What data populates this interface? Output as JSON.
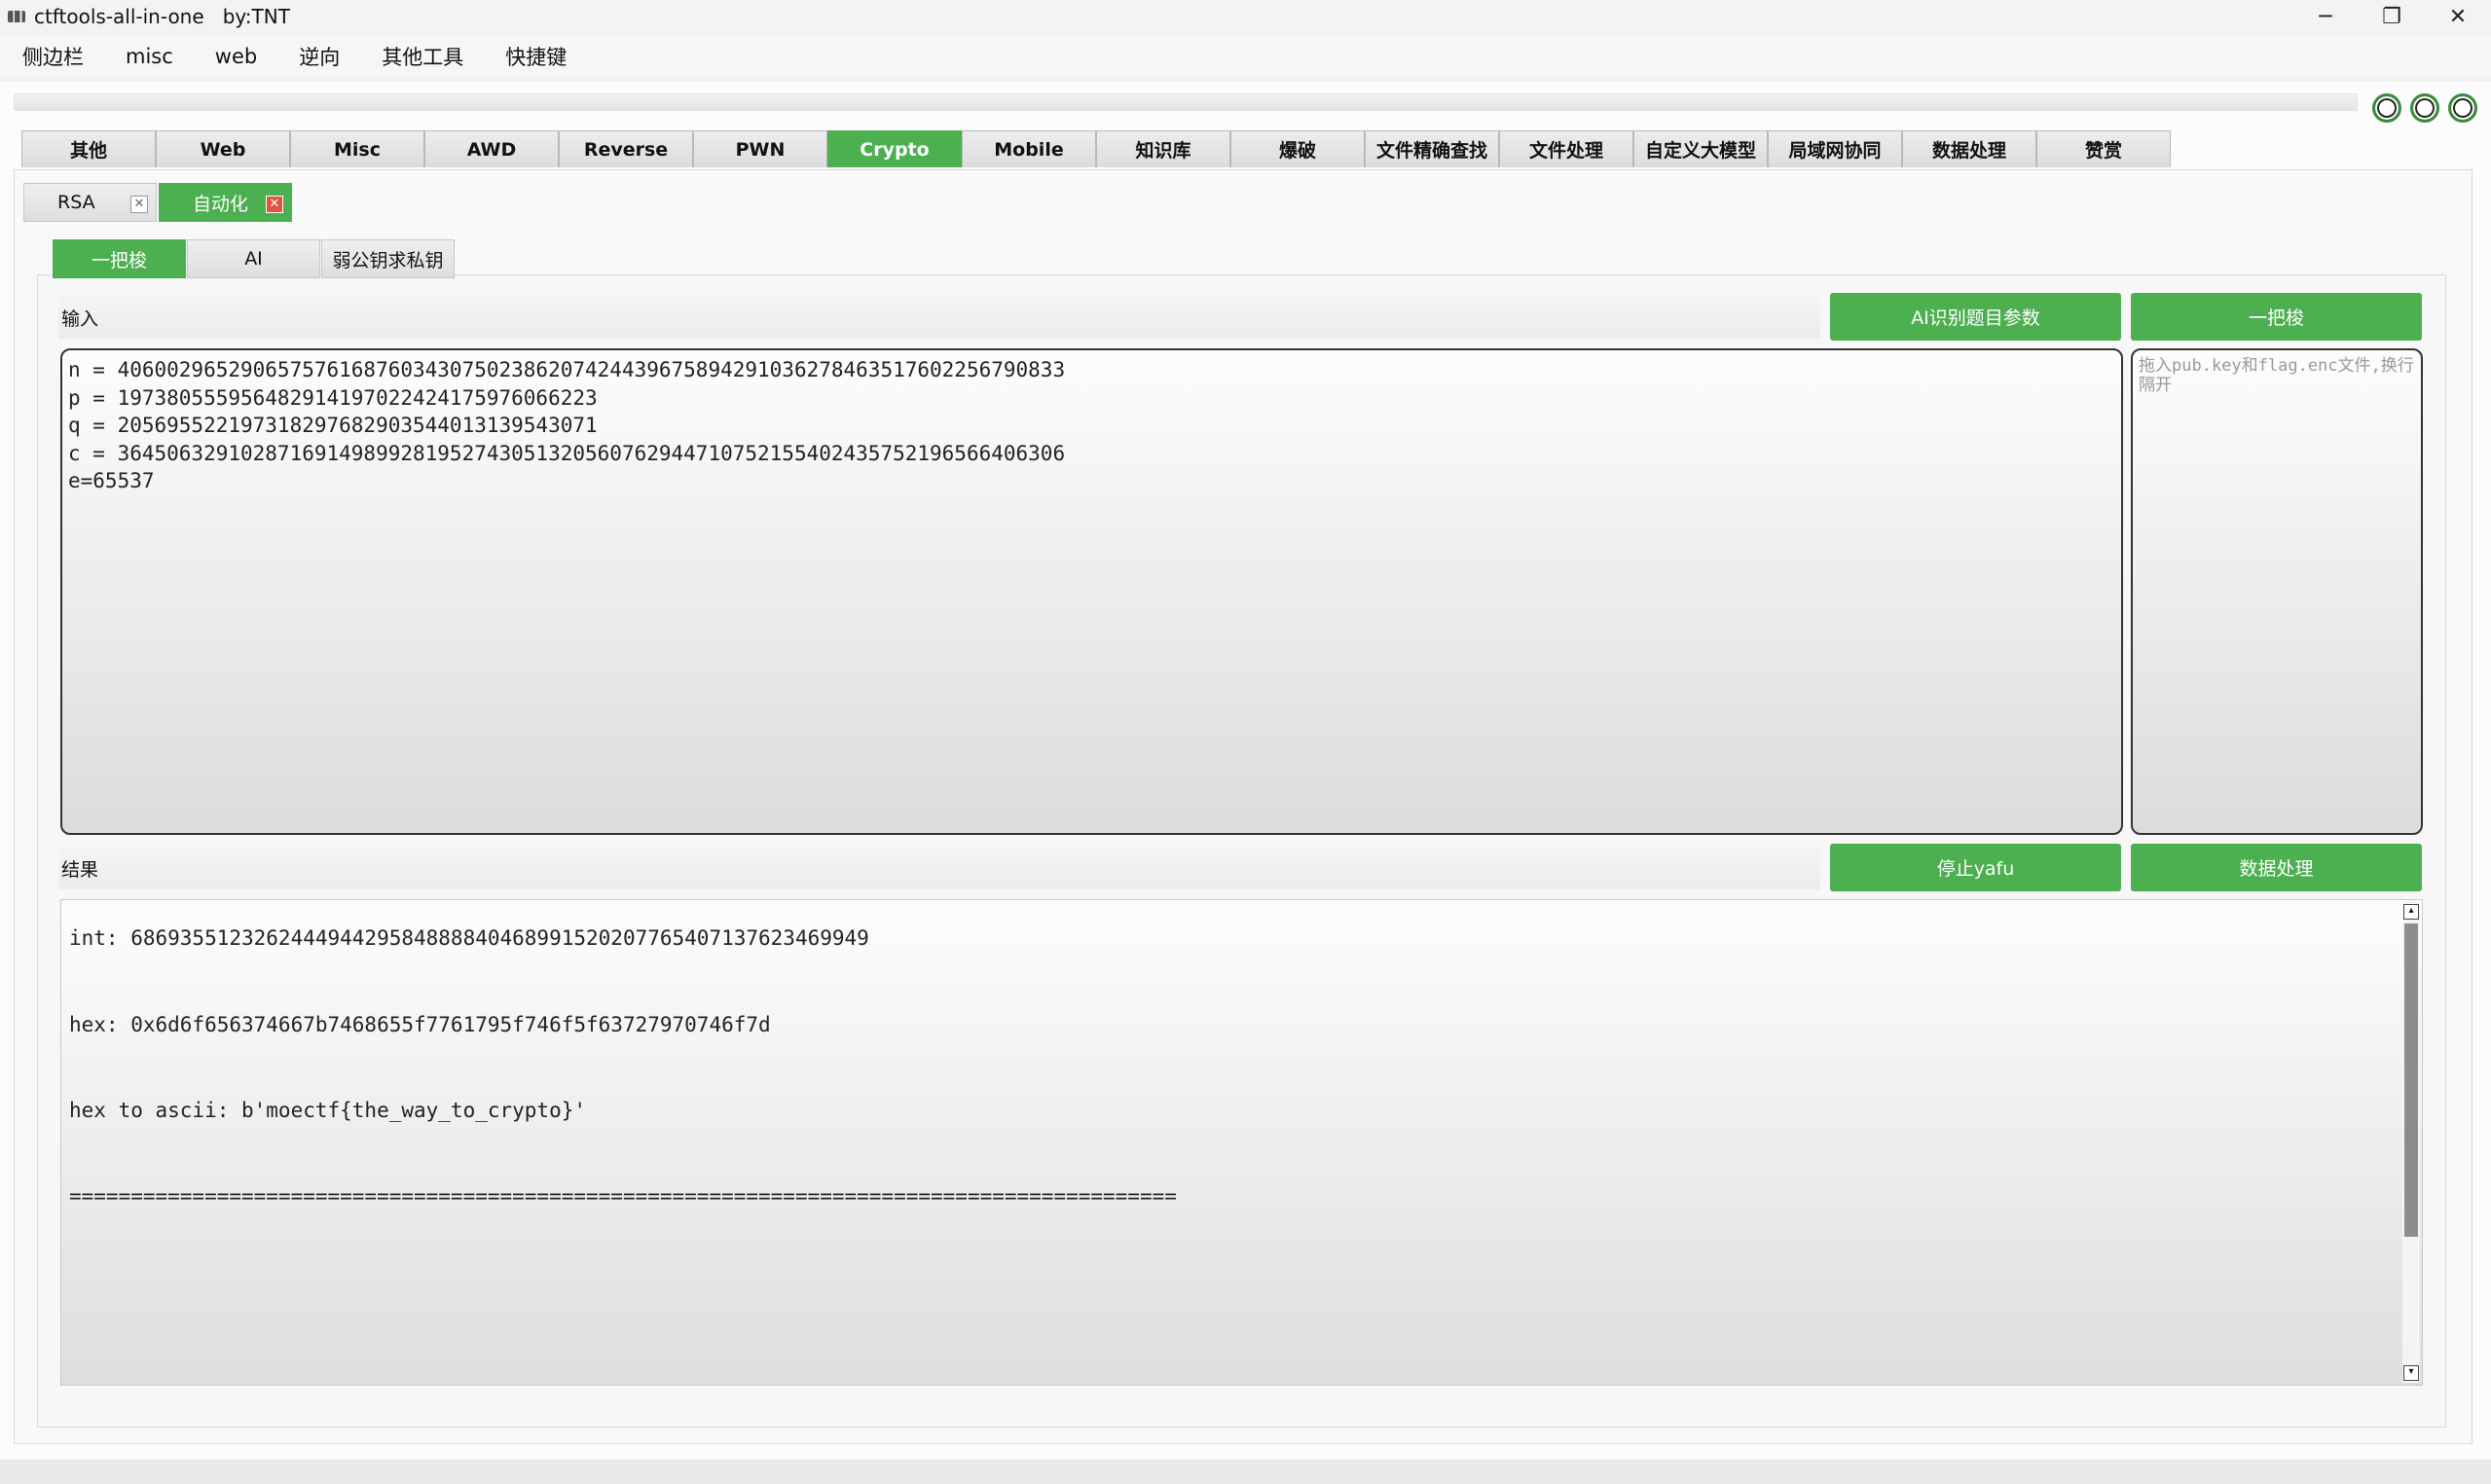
{
  "window": {
    "title": "ctftools-all-in-one   by:TNT",
    "controls": [
      "─",
      "❐",
      "✕"
    ]
  },
  "menu": [
    "侧边栏",
    "misc",
    "web",
    "逆向",
    "其他工具",
    "快捷键"
  ],
  "main_tabs": [
    "其他",
    "Web",
    "Misc",
    "AWD",
    "Reverse",
    "PWN",
    "Crypto",
    "Mobile",
    "知识库",
    "爆破",
    "文件精确查找",
    "文件处理",
    "自定义大模型",
    "局域网协同",
    "数据处理",
    "赞赏"
  ],
  "main_tabs_active": "Crypto",
  "sub_tabs": [
    {
      "label": "RSA",
      "close": "✕"
    },
    {
      "label": "自动化",
      "close": "✕"
    }
  ],
  "tool_tabs": [
    "一把梭",
    "AI",
    "弱公钥求私钥"
  ],
  "input_section": {
    "label": "输入",
    "ai_button": "AI识别题目参数",
    "run_button": "一把梭",
    "lines": [
      "n = 406002965290657576168760343075023862074244396758942910362784635176022567908​33",
      "p = 197380555956482914197022424175976066223",
      "q = 205695522197318297682903544013139543071",
      "c = 364506329102871691498992819527430513205607629447107521554024357521965664063​06",
      "e=65537"
    ],
    "drop_placeholder": "拖入pub.key和flag.enc文件,换行隔开"
  },
  "result_section": {
    "label": "结果",
    "stop_button": "停止yafu",
    "data_button": "数据处理",
    "lines": [
      "int: 686935512326244494429584888840468991520207765407137623469949",
      "hex: 0x6d6f656374667b7468655f7761795f746f5f63727970746f7d",
      "hex to ascii: b'moectf{the_way_to_crypto}'",
      "=========================================================================================="
    ]
  },
  "colors": {
    "accent": "#4caf50",
    "close_active": "#e0553d"
  }
}
